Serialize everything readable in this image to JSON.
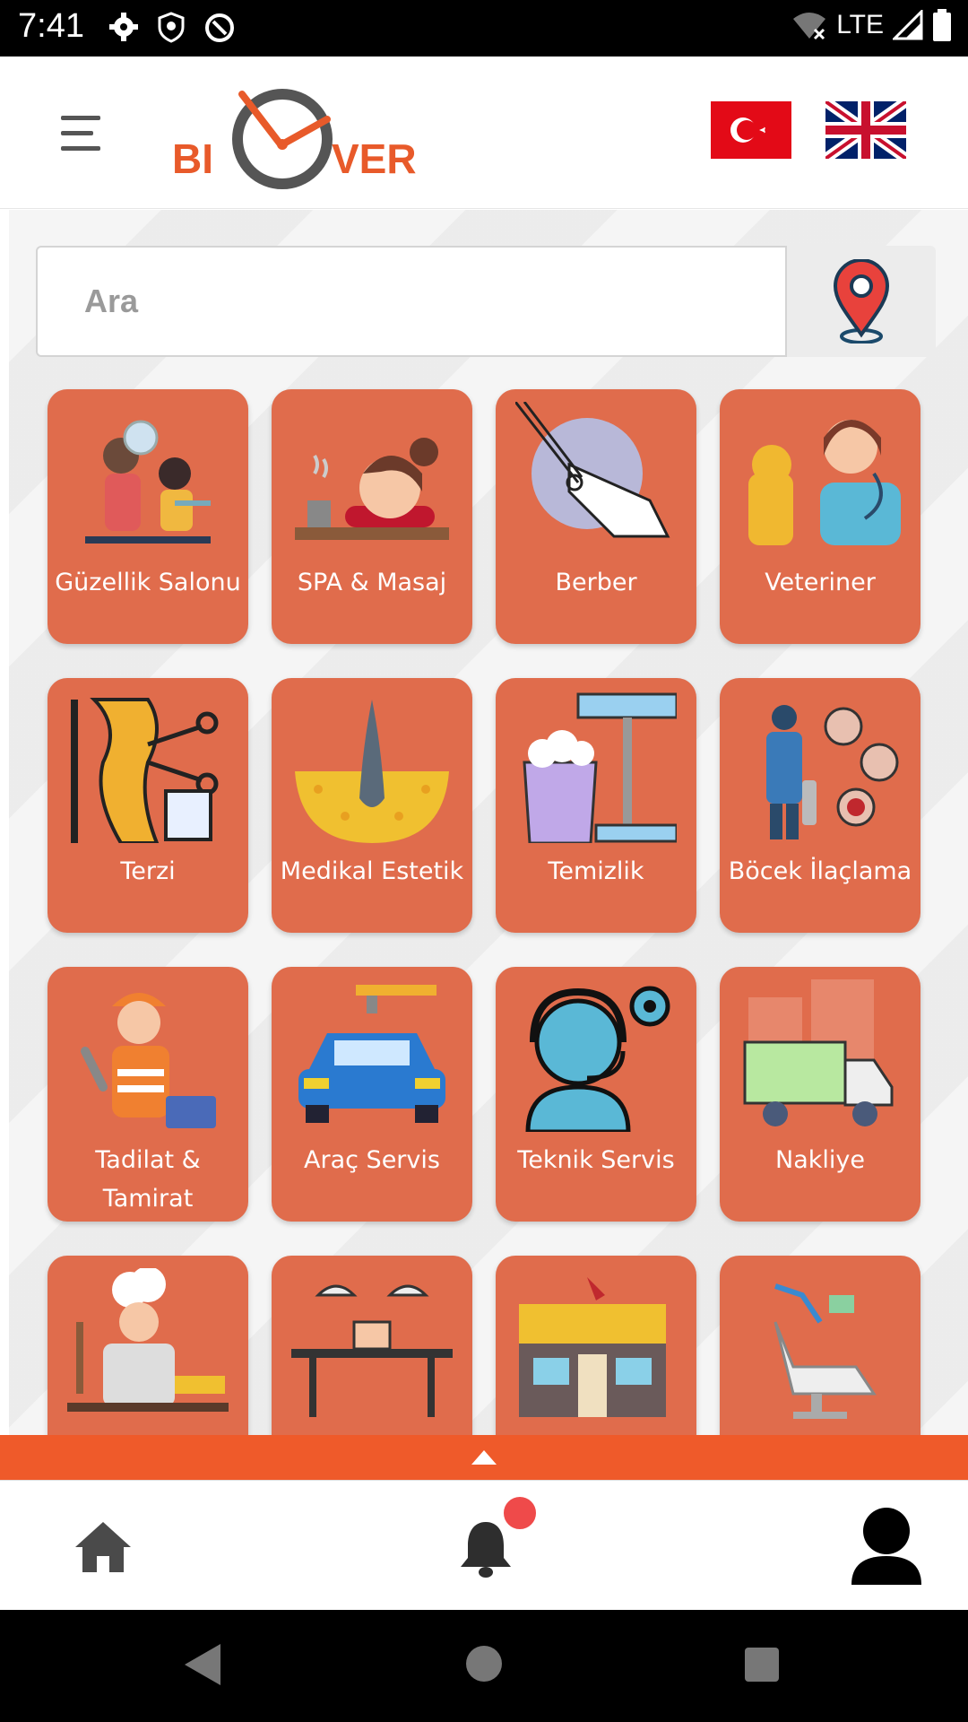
{
  "status_bar": {
    "time": "7:41",
    "network": "LTE"
  },
  "header": {
    "menu_icon": "hamburger-icon",
    "logo_text_left": "BI",
    "logo_text_right": "VER",
    "flags": [
      "turkey-flag",
      "uk-flag"
    ]
  },
  "search": {
    "placeholder": "Ara",
    "location_icon": "map-pin-icon"
  },
  "categories": [
    {
      "label": "Güzellik Salonu",
      "icon": "beauty-salon-icon"
    },
    {
      "label": "SPA & Masaj",
      "icon": "spa-massage-icon"
    },
    {
      "label": "Berber",
      "icon": "barber-scissors-icon"
    },
    {
      "label": "Veteriner",
      "icon": "veterinarian-icon"
    },
    {
      "label": "Terzi",
      "icon": "tailor-icon"
    },
    {
      "label": "Medikal Estetik",
      "icon": "medical-aesthetic-icon"
    },
    {
      "label": "Temizlik",
      "icon": "cleaning-icon"
    },
    {
      "label": "Böcek İlaçlama",
      "icon": "pest-control-icon"
    },
    {
      "label": "Tadilat & Tamirat",
      "icon": "repair-worker-icon"
    },
    {
      "label": "Araç Servis",
      "icon": "car-service-icon"
    },
    {
      "label": "Teknik Servis",
      "icon": "technical-support-icon"
    },
    {
      "label": "Nakliye",
      "icon": "moving-truck-icon"
    },
    {
      "label": "",
      "icon": "chef-icon"
    },
    {
      "label": "",
      "icon": "restaurant-icon"
    },
    {
      "label": "",
      "icon": "tattoo-shop-icon"
    },
    {
      "label": "",
      "icon": "dentist-chair-icon"
    }
  ],
  "bottom_nav": {
    "items": [
      "home-icon",
      "bell-icon",
      "profile-icon"
    ],
    "notification_badge_color": "#ef4a4a"
  },
  "colors": {
    "accent": "#ef5a2a",
    "tile": "#e06c4c"
  }
}
